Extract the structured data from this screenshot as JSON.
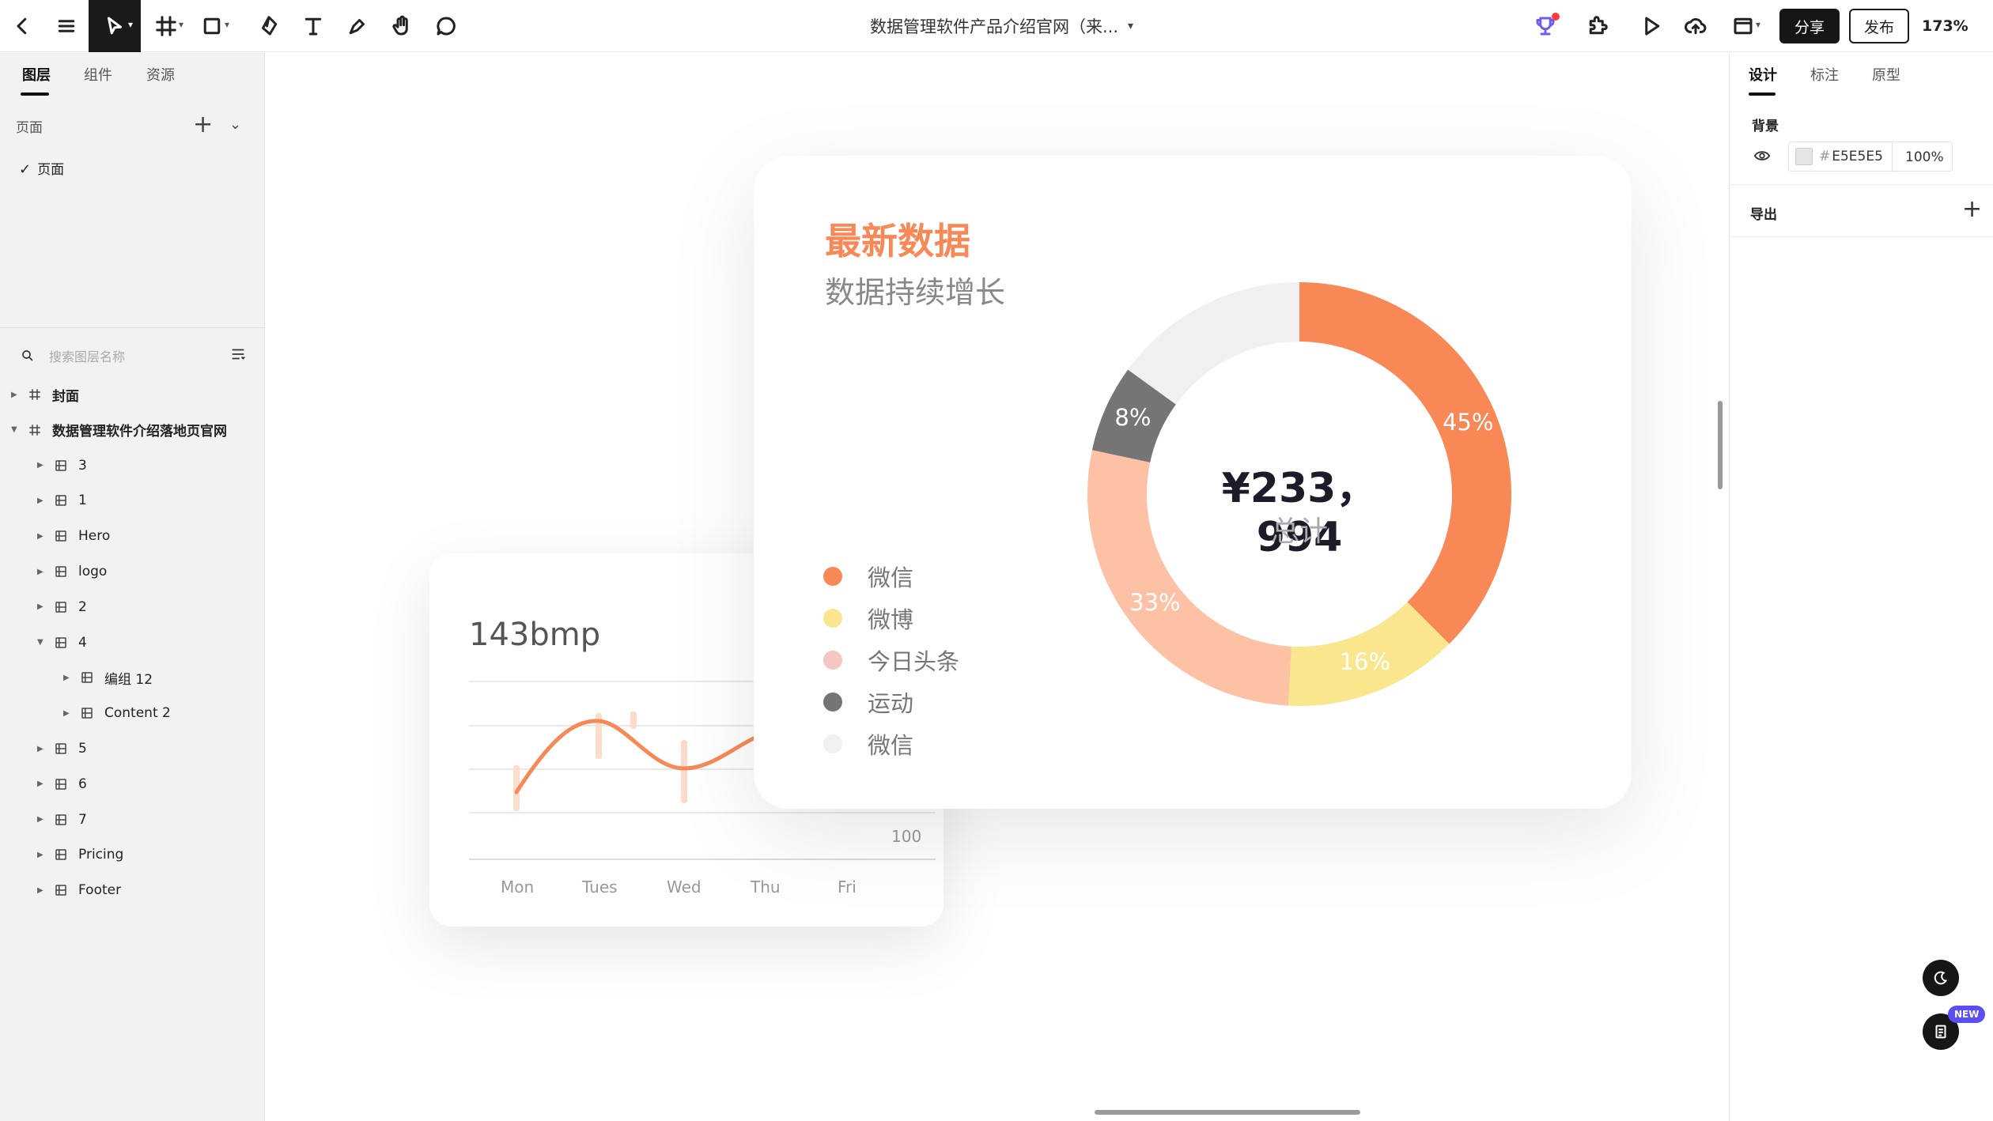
{
  "toolbar": {
    "doc_title": "数据管理软件产品介绍官网（来...",
    "share_label": "分享",
    "publish_label": "发布",
    "zoom": "173%"
  },
  "left_panel": {
    "tabs": [
      "图层",
      "组件",
      "资源"
    ],
    "pages_header": "页面",
    "pages": [
      "页面"
    ],
    "search_placeholder": "搜索图层名称",
    "layers": [
      {
        "label": "封面",
        "level": 0,
        "type": "frame",
        "expanded": false
      },
      {
        "label": "数据管理软件介绍落地页官网",
        "level": 0,
        "type": "frame",
        "expanded": true
      },
      {
        "label": "3",
        "level": 1,
        "type": "group",
        "expanded": false
      },
      {
        "label": "1",
        "level": 1,
        "type": "group",
        "expanded": false
      },
      {
        "label": "Hero",
        "level": 1,
        "type": "group",
        "expanded": false
      },
      {
        "label": "logo",
        "level": 1,
        "type": "group",
        "expanded": false
      },
      {
        "label": "2",
        "level": 1,
        "type": "group",
        "expanded": false
      },
      {
        "label": "4",
        "level": 1,
        "type": "group",
        "expanded": true
      },
      {
        "label": "编组 12",
        "level": 2,
        "type": "group",
        "expanded": false
      },
      {
        "label": "Content 2",
        "level": 2,
        "type": "group",
        "expanded": false
      },
      {
        "label": "5",
        "level": 1,
        "type": "group",
        "expanded": false
      },
      {
        "label": "6",
        "level": 1,
        "type": "group",
        "expanded": false
      },
      {
        "label": "7",
        "level": 1,
        "type": "group",
        "expanded": false
      },
      {
        "label": "Pricing",
        "level": 1,
        "type": "group",
        "expanded": false
      },
      {
        "label": "Footer",
        "level": 1,
        "type": "group",
        "expanded": false
      }
    ]
  },
  "right_panel": {
    "tabs": [
      "设计",
      "标注",
      "原型"
    ],
    "background_title": "背景",
    "background_hex": "E5E5E5",
    "background_opacity": "100%",
    "export_title": "导出"
  },
  "canvas": {
    "line_card": {
      "title": "143bmp",
      "value_label": "100",
      "days": [
        "Mon",
        "Tues",
        "Wed",
        "Thu",
        "Fri"
      ]
    },
    "donut_card": {
      "title": "最新数据",
      "subtitle": "数据持续增长",
      "total": "¥233，994",
      "total_label": "总计",
      "legend": [
        {
          "label": "微信",
          "color": "#F88957"
        },
        {
          "label": "微博",
          "color": "#FAE68C"
        },
        {
          "label": "今日头条",
          "color": "#F6C6C3"
        },
        {
          "label": "运动",
          "color": "#757575"
        },
        {
          "label": "微信",
          "color": "#F1EFEF"
        }
      ]
    }
  },
  "chart_data": {
    "type": "pie",
    "title": "最新数据",
    "subtitle": "数据持续增长",
    "center_value": "¥233，994",
    "center_label": "总计",
    "slices": [
      {
        "value": 45,
        "label": "45%",
        "color": "#F88957"
      },
      {
        "value": 16,
        "label": "16%",
        "color": "#FAE68C"
      },
      {
        "value": 33,
        "label": "33%",
        "color": "#FDC2A6"
      },
      {
        "value": 8,
        "label": "8%",
        "color": "#757575"
      },
      {
        "value": 18,
        "label": "",
        "color": "#F1EFEF"
      }
    ]
  },
  "colors": {
    "accent": "#F88957",
    "dark": "#161616"
  }
}
